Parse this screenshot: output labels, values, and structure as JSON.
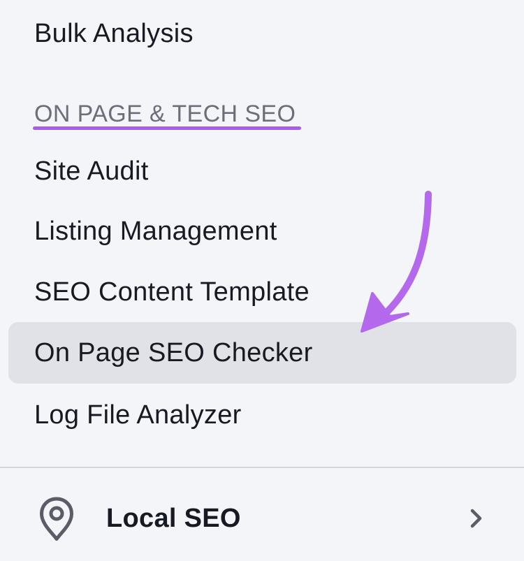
{
  "menu": {
    "bulk_analysis": "Bulk Analysis",
    "section_label": "ON PAGE & TECH SEO",
    "items": [
      {
        "label": "Site Audit"
      },
      {
        "label": "Listing Management"
      },
      {
        "label": "SEO Content Template"
      },
      {
        "label": "On Page SEO Checker",
        "highlighted": true
      },
      {
        "label": "Log File Analyzer"
      }
    ]
  },
  "local_seo": {
    "label": "Local SEO",
    "icon": "location-pin-icon",
    "chevron": "chevron-right-icon"
  },
  "colors": {
    "background": "#f4f5f9",
    "highlight": "#e1e2e8",
    "accent": "#a75ee8",
    "text": "#171a22",
    "section_text": "#6c6e79"
  }
}
